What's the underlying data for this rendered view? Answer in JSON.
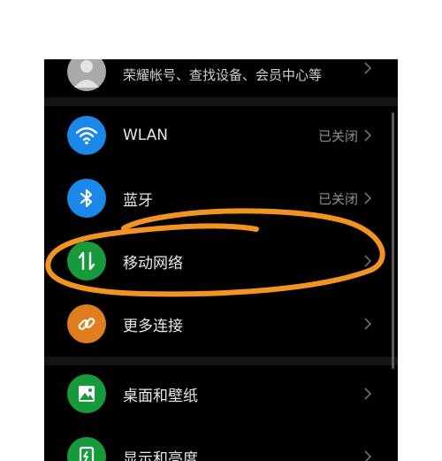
{
  "account": {
    "subtitle": "荣耀帐号、查找设备、会员中心等",
    "icon": "avatar-icon"
  },
  "items": [
    {
      "label": "WLAN",
      "status": "已关闭",
      "icon": "wifi-icon",
      "color": "#1a88e8"
    },
    {
      "label": "蓝牙",
      "status": "已关闭",
      "icon": "bluetooth-icon",
      "color": "#1a88e8"
    },
    {
      "label": "移动网络",
      "status": "",
      "icon": "mobile-data-icon",
      "color": "#179a3c"
    },
    {
      "label": "更多连接",
      "status": "",
      "icon": "link-icon",
      "color": "#e07d1f"
    },
    {
      "label": "桌面和壁纸",
      "status": "",
      "icon": "wallpaper-icon",
      "color": "#179a3c"
    },
    {
      "label": "显示和亮度",
      "status": "",
      "icon": "display-icon",
      "color": "#179a3c"
    }
  ],
  "annotation": {
    "color": "#f29422",
    "shape": "hand-drawn-circle"
  }
}
